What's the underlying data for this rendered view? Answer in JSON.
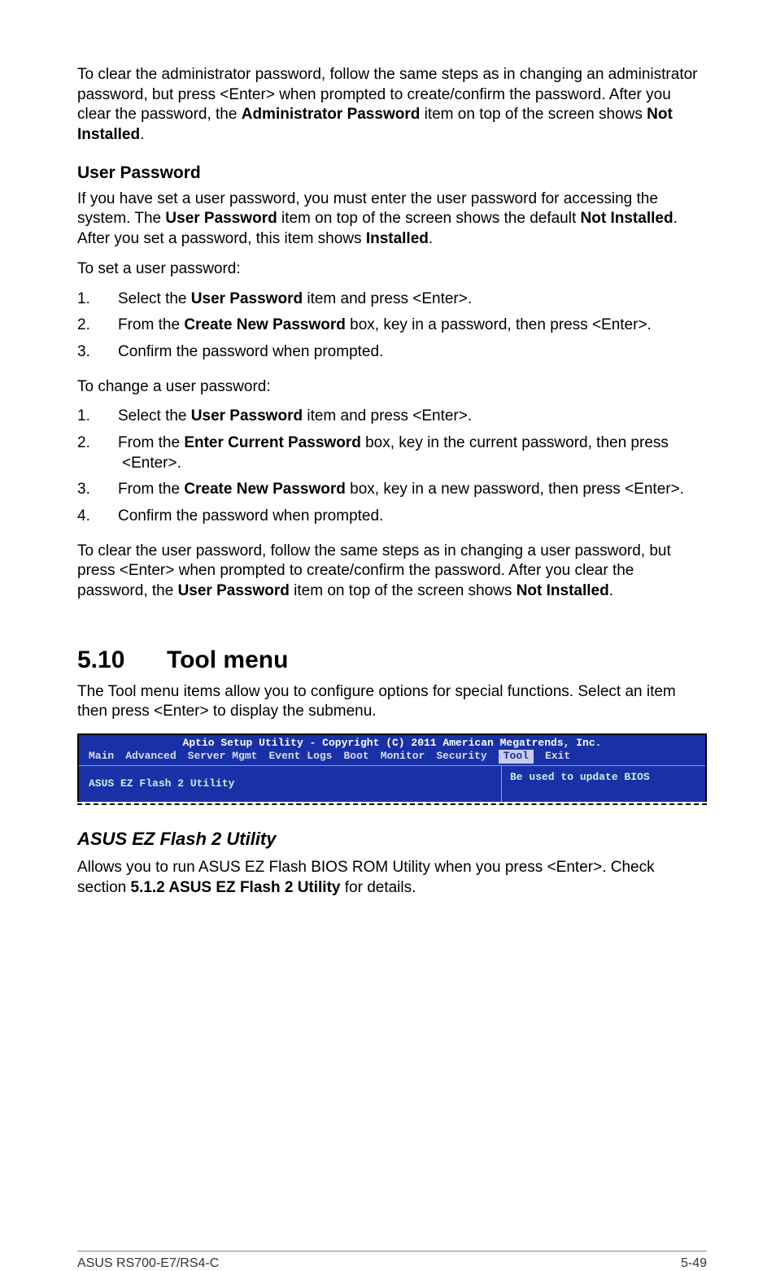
{
  "para_clear_admin": "To clear the administrator password, follow the same steps as in changing an administrator password, but press <Enter> when prompted to create/confirm the password. After you clear the password, the ",
  "bold_admin_pw": "Administrator Password",
  "para_clear_admin_tail": " item on top of the screen shows ",
  "bold_not_installed": "Not Installed",
  "period": ".",
  "heading_user_pw": "User Password",
  "user_pw_intro_a": "If you have set a user password, you must enter the user password for accessing the system. The ",
  "bold_user_pw": "User Password",
  "user_pw_intro_b": " item on top of the screen shows the default ",
  "user_pw_intro_c": ". After you set a password, this item shows ",
  "bold_installed": "Installed",
  "to_set": "To set a user password:",
  "set_steps": [
    {
      "n": "1.",
      "pre": "Select the ",
      "bold": "User Password",
      "post": " item and press <Enter>."
    },
    {
      "n": "2.",
      "pre": "From the ",
      "bold": "Create New Password",
      "post": " box, key in a password, then press <Enter>."
    },
    {
      "n": "3.",
      "pre": "Confirm the password when prompted.",
      "bold": "",
      "post": ""
    }
  ],
  "to_change": "To change a user password:",
  "change_steps": [
    {
      "n": "1.",
      "pre": "Select the ",
      "bold": "User Password",
      "post": " item and press <Enter>."
    },
    {
      "n": "2.",
      "pre": "From the ",
      "bold": "Enter Current Password",
      "post": " box, key in the current password, then press <Enter>."
    },
    {
      "n": "3.",
      "pre": "From the ",
      "bold": "Create New Password",
      "post": " box, key in a new password, then press <Enter>."
    },
    {
      "n": "4.",
      "pre": "Confirm the password when prompted.",
      "bold": "",
      "post": ""
    }
  ],
  "clear_user_pw_a": "To clear the user password, follow the same steps as in changing a user password, but press <Enter> when prompted to create/confirm the password. After you clear the password, the ",
  "clear_user_pw_b": " item on top of the screen shows ",
  "section_num": "5.10",
  "section_title": "Tool menu",
  "tool_intro": "The Tool menu items allow you to configure options for special functions. Select an item then press <Enter> to display the submenu.",
  "bios": {
    "title": "Aptio Setup Utility - Copyright (C) 2011 American Megatrends, Inc.",
    "menu": [
      "Main",
      "Advanced",
      "Server Mgmt",
      "Event Logs",
      "Boot",
      "Monitor",
      "Security",
      "Tool",
      "Exit"
    ],
    "active_index": 7,
    "left": "ASUS EZ Flash 2 Utility",
    "right": "Be used to update BIOS"
  },
  "ez_heading": "ASUS EZ Flash 2 Utility",
  "ez_para_a": "Allows you to run ASUS EZ Flash BIOS ROM Utility when you press <Enter>. Check section ",
  "ez_bold": "5.1.2 ASUS EZ Flash 2 Utility",
  "ez_para_b": " for details.",
  "footer_left": "ASUS RS700-E7/RS4-C",
  "footer_right": "5-49"
}
